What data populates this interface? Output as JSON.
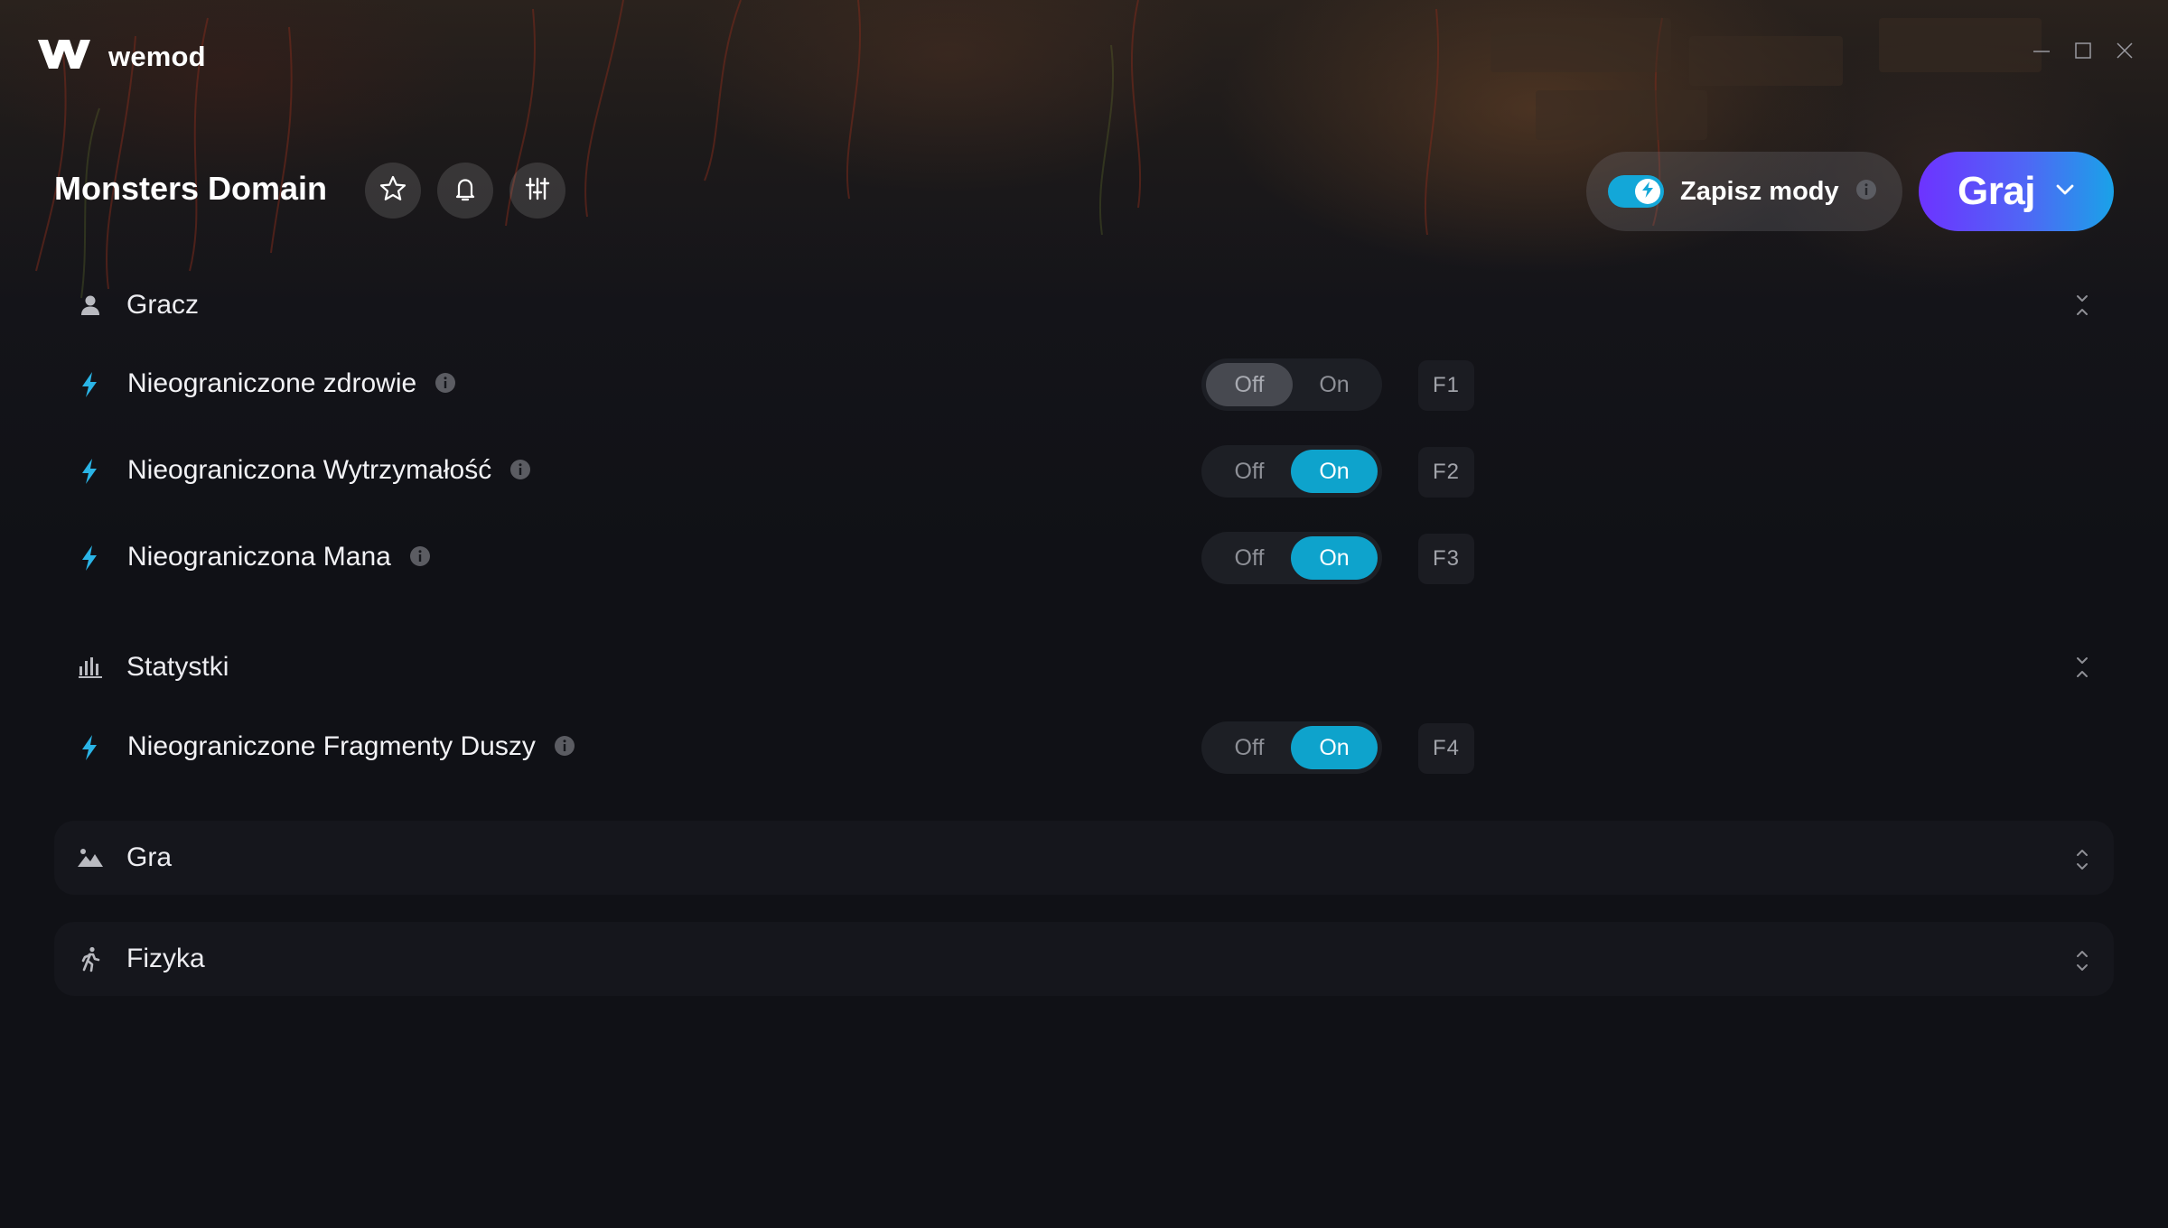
{
  "app": {
    "name": "wemod"
  },
  "window_controls": [
    "minimize-icon",
    "maximize-icon",
    "close-icon"
  ],
  "header": {
    "game_title": "Monsters Domain",
    "icons": [
      "star-icon",
      "bell-icon",
      "sliders-icon"
    ],
    "save_mods": {
      "label": "Zapisz mody",
      "enabled": true
    },
    "play": {
      "label": "Graj"
    }
  },
  "sections": {
    "player": {
      "label": "Gracz",
      "icon": "person-icon",
      "expanded": true,
      "mods": [
        {
          "name": "Nieograniczone zdrowie",
          "off": "Off",
          "on": "On",
          "state": "off",
          "hotkey": "F1"
        },
        {
          "name": "Nieograniczona Wytrzymałość",
          "off": "Off",
          "on": "On",
          "state": "on",
          "hotkey": "F2"
        },
        {
          "name": "Nieograniczona Mana",
          "off": "Off",
          "on": "On",
          "state": "on",
          "hotkey": "F3"
        }
      ]
    },
    "stats": {
      "label": "Statystki",
      "icon": "bar-chart-icon",
      "expanded": true,
      "mods": [
        {
          "name": "Nieograniczone Fragmenty Duszy",
          "off": "Off",
          "on": "On",
          "state": "on",
          "hotkey": "F4"
        }
      ]
    },
    "game": {
      "label": "Gra",
      "icon": "landscape-icon",
      "expanded": false
    },
    "physics": {
      "label": "Fizyka",
      "icon": "running-person-icon",
      "expanded": false
    }
  },
  "colors": {
    "accent_on": "#0ea3cc",
    "play_gradient_start": "#6d33ff",
    "play_gradient_end": "#1aa2e8",
    "bolt": "#2ab4e6"
  }
}
